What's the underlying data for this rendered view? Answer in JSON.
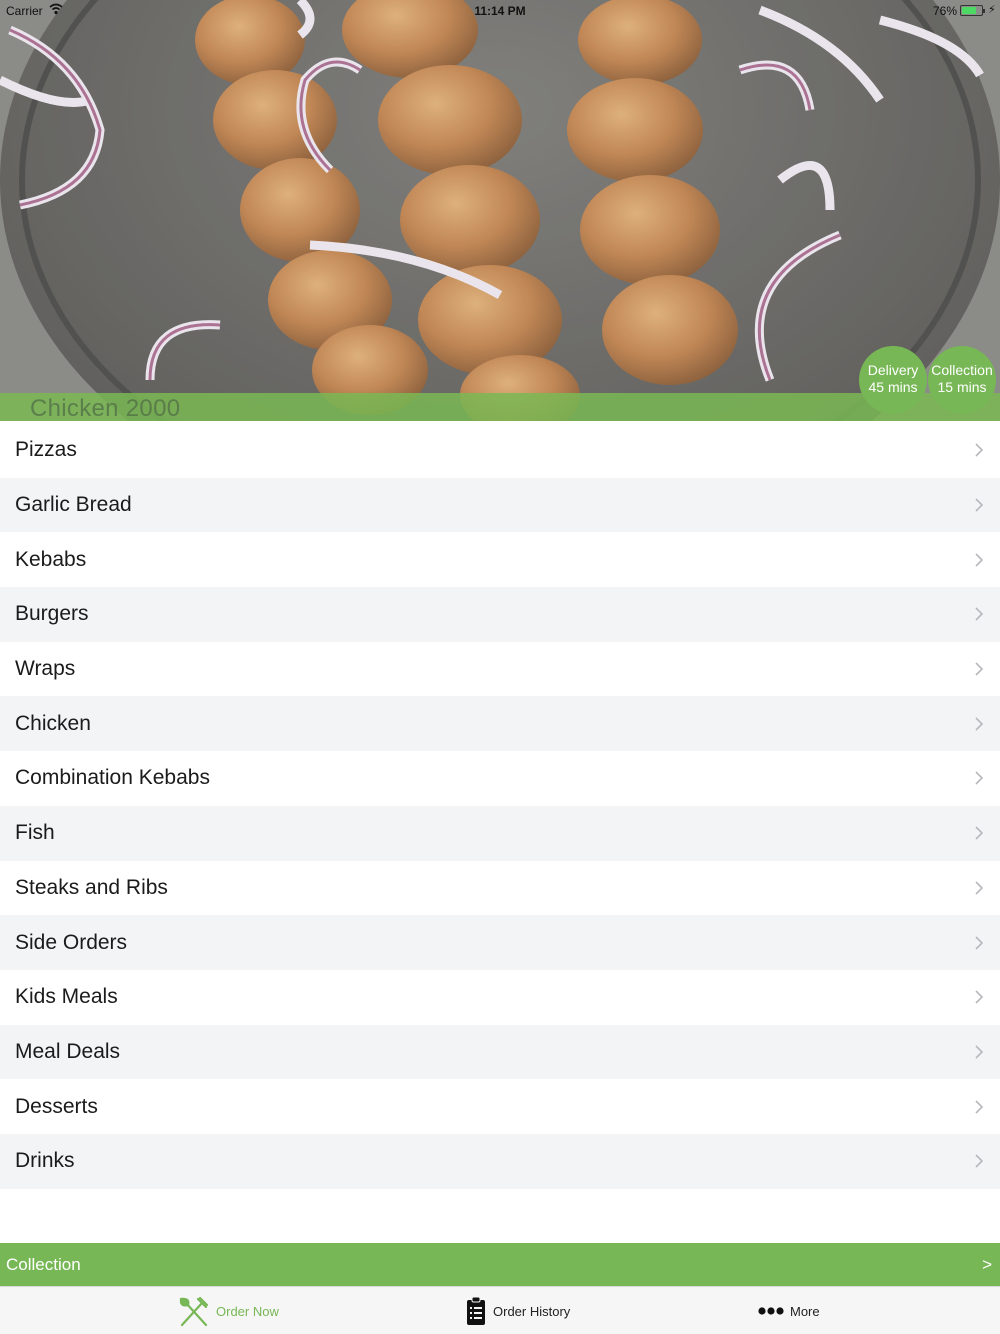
{
  "status_bar": {
    "carrier": "Carrier",
    "time": "11:14 PM",
    "battery_percent": "76%",
    "battery_level": 0.76
  },
  "header": {
    "restaurant_name": "Chicken 2000",
    "delivery": {
      "label": "Delivery",
      "time": "45 mins"
    },
    "collection": {
      "label": "Collection",
      "time": "15 mins"
    }
  },
  "categories": [
    {
      "label": "Pizzas"
    },
    {
      "label": "Garlic Bread"
    },
    {
      "label": "Kebabs"
    },
    {
      "label": "Burgers"
    },
    {
      "label": "Wraps"
    },
    {
      "label": "Chicken"
    },
    {
      "label": "Combination Kebabs"
    },
    {
      "label": "Fish"
    },
    {
      "label": "Steaks and Ribs"
    },
    {
      "label": "Side Orders"
    },
    {
      "label": "Kids Meals"
    },
    {
      "label": "Meal Deals"
    },
    {
      "label": "Desserts"
    },
    {
      "label": "Drinks"
    }
  ],
  "order_mode_bar": {
    "label": "Collection",
    "arrow": ">"
  },
  "tab_bar": {
    "tabs": [
      {
        "label": "Order Now",
        "icon": "fork-knife-icon",
        "active": true
      },
      {
        "label": "Order History",
        "icon": "clipboard-list-icon",
        "active": false
      },
      {
        "label": "More",
        "icon": "more-dots-icon",
        "active": false
      }
    ]
  },
  "colors": {
    "accent_green": "#78b756",
    "row_alt_background": "#f3f4f6",
    "tab_bar_background": "#f6f6f6"
  }
}
